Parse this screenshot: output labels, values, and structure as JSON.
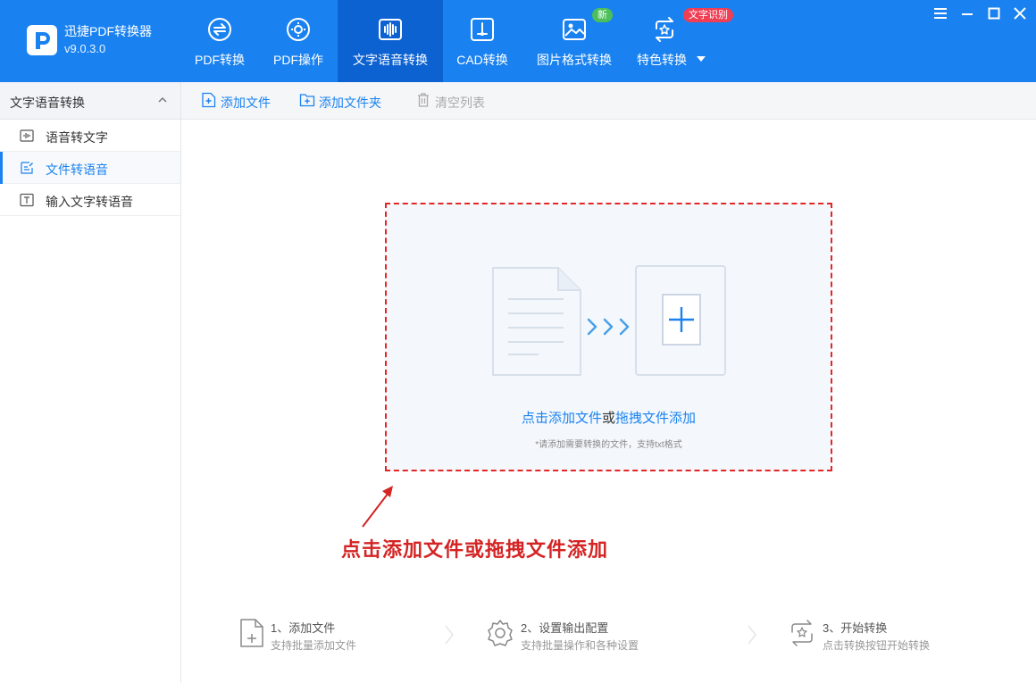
{
  "app": {
    "name": "迅捷PDF转换器",
    "version": "v9.0.3.0"
  },
  "nav": {
    "tabs": [
      {
        "label": "PDF转换",
        "icon": "pdf-convert-icon"
      },
      {
        "label": "PDF操作",
        "icon": "pdf-operate-icon"
      },
      {
        "label": "文字语音转换",
        "icon": "audio-wave-icon",
        "active": true
      },
      {
        "label": "CAD转换",
        "icon": "cad-icon"
      },
      {
        "label": "图片格式转换",
        "icon": "image-icon"
      },
      {
        "label": "特色转换",
        "icon": "special-convert-icon"
      }
    ],
    "badge_new": "新",
    "badge_ocr": "文字识别"
  },
  "sidebar": {
    "title": "文字语音转换",
    "items": [
      {
        "label": "语音转文字",
        "icon": "audio-icon"
      },
      {
        "label": "文件转语音",
        "icon": "file-edit-icon",
        "active": true
      },
      {
        "label": "输入文字转语音",
        "icon": "text-box-icon"
      }
    ]
  },
  "toolbar": {
    "add_file": "添加文件",
    "add_folder": "添加文件夹",
    "clear_list": "清空列表"
  },
  "dropzone": {
    "click_add": "点击添加文件",
    "or": "或",
    "drag_add": "拖拽文件添加",
    "hint": "*请添加需要转换的文件，支持txt格式"
  },
  "annotation": {
    "text": "点击添加文件或拖拽文件添加"
  },
  "steps": [
    {
      "title": "1、添加文件",
      "subtitle": "支持批量添加文件"
    },
    {
      "title": "2、设置输出配置",
      "subtitle": "支持批量操作和各种设置"
    },
    {
      "title": "3、开始转换",
      "subtitle": "点击转换按钮开始转换"
    }
  ],
  "colors": {
    "brand": "#1a82f0",
    "active_tab": "#0d62d1",
    "annotation": "#d42424",
    "badge_new": "#4cbf5a",
    "badge_ocr": "#f03e54"
  }
}
